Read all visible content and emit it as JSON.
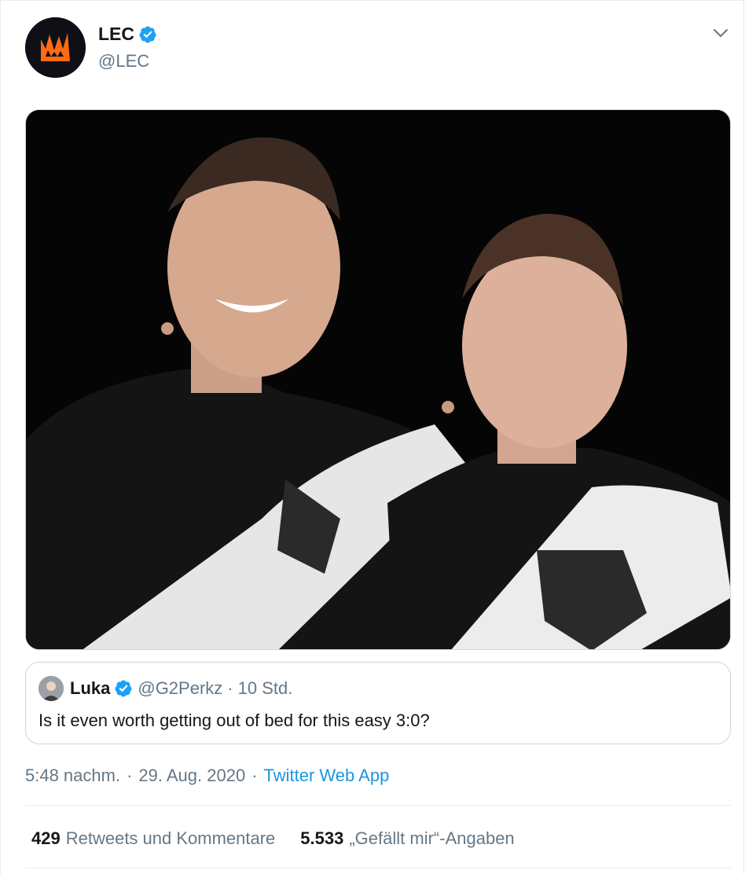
{
  "author": {
    "display_name": "LEC",
    "handle": "@LEC",
    "avatar_icon": "lec-logo-icon",
    "verified": true
  },
  "media": {
    "description_icon": "photo-two-players-icon"
  },
  "quoted_tweet": {
    "display_name": "Luka",
    "handle": "@G2Perkz",
    "separator": "·",
    "time_ago": "10 Std.",
    "text": "Is it even worth getting out of bed for this easy 3:0?",
    "verified": true
  },
  "meta": {
    "time": "5:48 nachm.",
    "separator1": "·",
    "date": "29. Aug. 2020",
    "separator2": "·",
    "source": "Twitter Web App"
  },
  "stats": {
    "retweets_count": "429",
    "retweets_label": "Retweets und Kommentare",
    "likes_count": "5.533",
    "likes_label": "„Gefällt mir“-Angaben"
  },
  "colors": {
    "link": "#1b95e0",
    "secondary_text": "#657786",
    "verified_badge": "#1da1f2",
    "lec_orange": "#ff6a13"
  }
}
